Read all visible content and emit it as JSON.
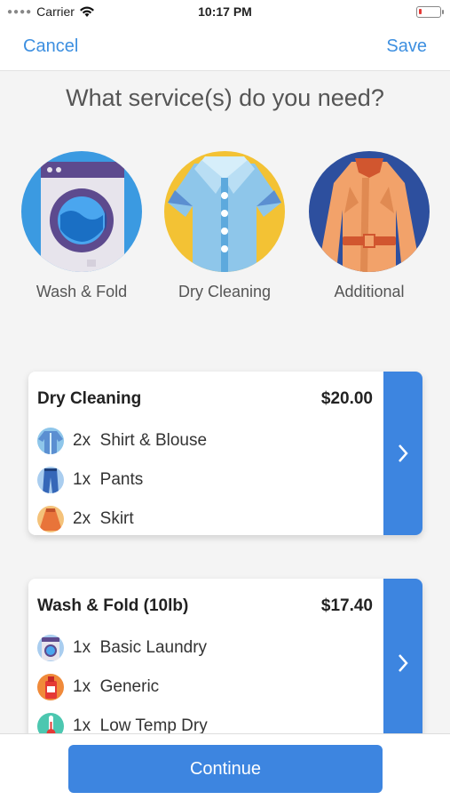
{
  "status": {
    "carrier": "Carrier",
    "time": "10:17 PM"
  },
  "nav": {
    "cancel": "Cancel",
    "save": "Save"
  },
  "question": "What service(s) do you need?",
  "services": [
    {
      "label": "Wash & Fold",
      "icon": "washing-machine-icon"
    },
    {
      "label": "Dry Cleaning",
      "icon": "shirt-icon"
    },
    {
      "label": "Additional",
      "icon": "coat-icon"
    }
  ],
  "cards": [
    {
      "title": "Dry Cleaning",
      "price": "$20.00",
      "items": [
        {
          "qty": "2x",
          "name": "Shirt & Blouse",
          "icon": "shirt-icon"
        },
        {
          "qty": "1x",
          "name": "Pants",
          "icon": "pants-icon"
        },
        {
          "qty": "2x",
          "name": "Skirt",
          "icon": "skirt-icon"
        }
      ]
    },
    {
      "title": "Wash & Fold (10lb)",
      "price": "$17.40",
      "items": [
        {
          "qty": "1x",
          "name": "Basic Laundry",
          "icon": "washer-icon"
        },
        {
          "qty": "1x",
          "name": "Generic",
          "icon": "detergent-icon"
        },
        {
          "qty": "1x",
          "name": "Low Temp Dry",
          "icon": "thermometer-icon"
        }
      ]
    }
  ],
  "continue": "Continue",
  "colors": {
    "accent": "#3d85e0",
    "link": "#3d8fe0"
  }
}
